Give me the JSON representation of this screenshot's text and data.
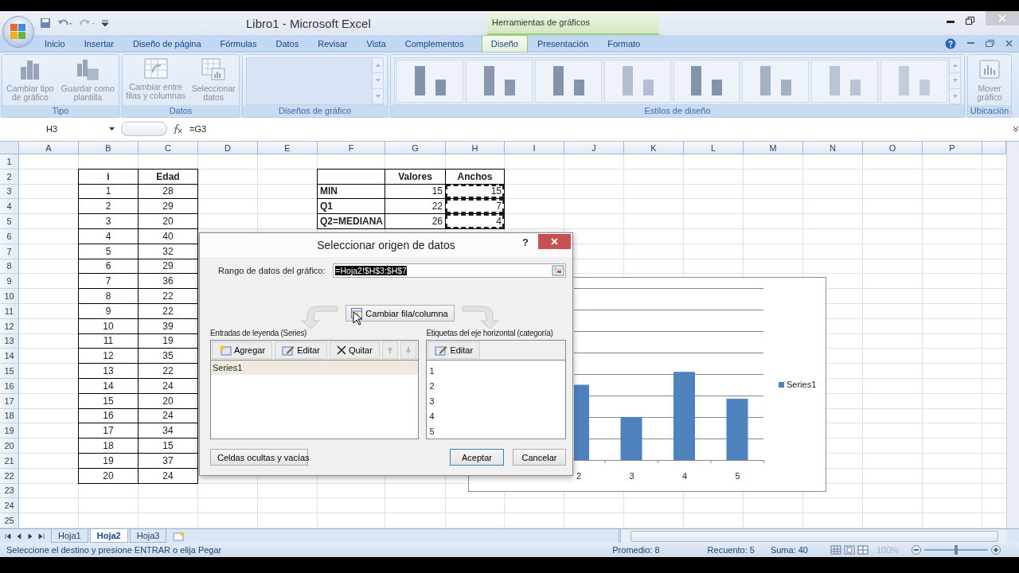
{
  "window": {
    "title": "Libro1 - Microsoft Excel",
    "context_label": "Herramientas de gráficos"
  },
  "ribbon_tabs": [
    {
      "label": "Inicio",
      "selected": false
    },
    {
      "label": "Insertar",
      "selected": false
    },
    {
      "label": "Diseño de página",
      "selected": false
    },
    {
      "label": "Fórmulas",
      "selected": false
    },
    {
      "label": "Datos",
      "selected": false
    },
    {
      "label": "Revisar",
      "selected": false
    },
    {
      "label": "Vista",
      "selected": false
    },
    {
      "label": "Complementos",
      "selected": false
    },
    {
      "label": "Diseño",
      "selected": true
    },
    {
      "label": "Presentación",
      "selected": false
    },
    {
      "label": "Formato",
      "selected": false
    }
  ],
  "ribbon_groups": [
    {
      "label": "Tipo",
      "kind": "buttons",
      "buttons": [
        {
          "lines": [
            "Cambiar tipo",
            "de gráfico"
          ],
          "disabled": true,
          "kind": "chart"
        },
        {
          "lines": [
            "Guardar como",
            "plantilla"
          ],
          "disabled": true,
          "kind": "template"
        }
      ]
    },
    {
      "label": "Datos",
      "kind": "buttons",
      "buttons": [
        {
          "lines": [
            "Cambiar entre",
            "filas y columnas"
          ],
          "disabled": true,
          "kind": "swap"
        },
        {
          "lines": [
            "Seleccionar",
            "datos"
          ],
          "disabled": true,
          "kind": "select"
        }
      ]
    },
    {
      "label": "Diseños de gráfico",
      "kind": "gallery"
    },
    {
      "label": "Estilos de diseño",
      "kind": "styles"
    },
    {
      "label": "Ubicación",
      "kind": "buttons",
      "buttons": [
        {
          "lines": [
            "Mover",
            "gráfico"
          ],
          "disabled": true,
          "kind": "move"
        }
      ]
    }
  ],
  "formula_bar": {
    "name_box": "H3",
    "formula": "=G3"
  },
  "sheet": {
    "columns": [
      "A",
      "B",
      "C",
      "D",
      "E",
      "F",
      "G",
      "H",
      "I",
      "J",
      "K",
      "L",
      "M",
      "N",
      "O",
      "P"
    ],
    "rows": [
      "1",
      "2",
      "3",
      "4",
      "5",
      "6",
      "7",
      "8",
      "9",
      "10",
      "11",
      "12",
      "13",
      "14",
      "15",
      "16",
      "17",
      "18",
      "19",
      "20",
      "21",
      "22",
      "23",
      "24",
      "25"
    ]
  },
  "age_table": {
    "headers": [
      "i",
      "Edad"
    ],
    "rows": [
      [
        "1",
        "28"
      ],
      [
        "2",
        "29"
      ],
      [
        "3",
        "20"
      ],
      [
        "4",
        "40"
      ],
      [
        "5",
        "32"
      ],
      [
        "6",
        "29"
      ],
      [
        "7",
        "36"
      ],
      [
        "8",
        "22"
      ],
      [
        "9",
        "22"
      ],
      [
        "10",
        "39"
      ],
      [
        "11",
        "19"
      ],
      [
        "12",
        "35"
      ],
      [
        "13",
        "22"
      ],
      [
        "14",
        "24"
      ],
      [
        "15",
        "20"
      ],
      [
        "16",
        "24"
      ],
      [
        "17",
        "34"
      ],
      [
        "18",
        "15"
      ],
      [
        "19",
        "37"
      ],
      [
        "20",
        "24"
      ]
    ]
  },
  "stats_table": {
    "headers": [
      "Valores",
      "Anchos"
    ],
    "rows": [
      {
        "label": "MIN",
        "values": [
          "15",
          "15"
        ],
        "copy_marked": true
      },
      {
        "label": "Q1",
        "values": [
          "22",
          "7"
        ],
        "copy_marked": true
      },
      {
        "label": "Q2=MEDIANA",
        "values": [
          "26",
          "4"
        ],
        "copy_marked": true
      }
    ]
  },
  "chart": {
    "categories": [
      "2",
      "3",
      "4",
      "5"
    ],
    "legend": "Series1"
  },
  "dialog": {
    "title": "Seleccionar origen de datos",
    "help": "?",
    "range_label": "Rango de datos del gráfico:",
    "range_value": "=Hoja2!$H$3:$H$7",
    "range_highlighted": true,
    "switch_button": "Cambiar fila/columna",
    "series_label": "Entradas de leyenda (Series)",
    "series_buttons": [
      {
        "label": "Agregar",
        "kind": "add",
        "disabled": false
      },
      {
        "label": "Editar",
        "kind": "edit",
        "disabled": false
      },
      {
        "label": "Quitar",
        "kind": "remove",
        "disabled": false
      },
      {
        "kind": "up",
        "disabled": true
      },
      {
        "kind": "down",
        "disabled": true
      }
    ],
    "series": [
      {
        "label": "Series1",
        "selected": true
      }
    ],
    "category_label": "Etiquetas del eje horizontal (categoría)",
    "category_buttons": [
      {
        "label": "Editar",
        "kind": "edit",
        "disabled": false
      }
    ],
    "categories": [
      "1",
      "2",
      "3",
      "4",
      "5"
    ],
    "hidden_cells_button": "Celdas ocultas y vacías",
    "ok_button": "Aceptar",
    "cancel_button": "Cancelar"
  },
  "sheet_tabs": [
    {
      "label": "Hoja1",
      "selected": false
    },
    {
      "label": "Hoja2",
      "selected": true
    },
    {
      "label": "Hoja3",
      "selected": false
    }
  ],
  "status_bar": {
    "message": "Seleccione el destino y presione ENTRAR o elija Pegar",
    "stats": [
      "Promedio: 8",
      "Recuento: 5",
      "Suma: 40"
    ],
    "zoom": "100%",
    "zoom_slider": {
      "level": 0.5
    }
  }
}
